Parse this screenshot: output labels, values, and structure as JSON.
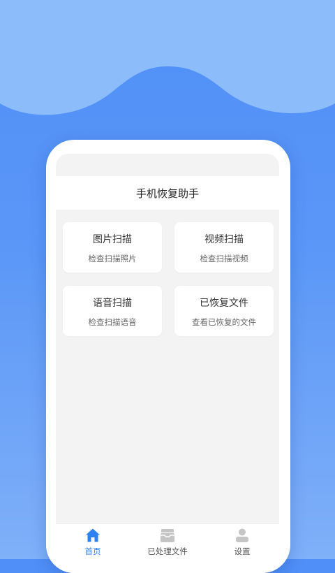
{
  "app": {
    "title": "手机恢复助手"
  },
  "cards": [
    {
      "title": "图片扫描",
      "subtitle": "检查扫描照片"
    },
    {
      "title": "视频扫描",
      "subtitle": "检查扫描视频"
    },
    {
      "title": "语音扫描",
      "subtitle": "检查扫描语音"
    },
    {
      "title": "已恢复文件",
      "subtitle": "查看已恢复的文件"
    }
  ],
  "tabbar": {
    "items": [
      {
        "label": "首页",
        "icon": "home-icon",
        "active": true
      },
      {
        "label": "已处理文件",
        "icon": "folder-stack-icon",
        "active": false
      },
      {
        "label": "设置",
        "icon": "user-settings-icon",
        "active": false
      }
    ]
  },
  "colors": {
    "accent": "#2f80f0",
    "background_top": "#4f8ff7",
    "background_bottom": "#7fb0f8",
    "screen_bg": "#f3f3f3"
  }
}
